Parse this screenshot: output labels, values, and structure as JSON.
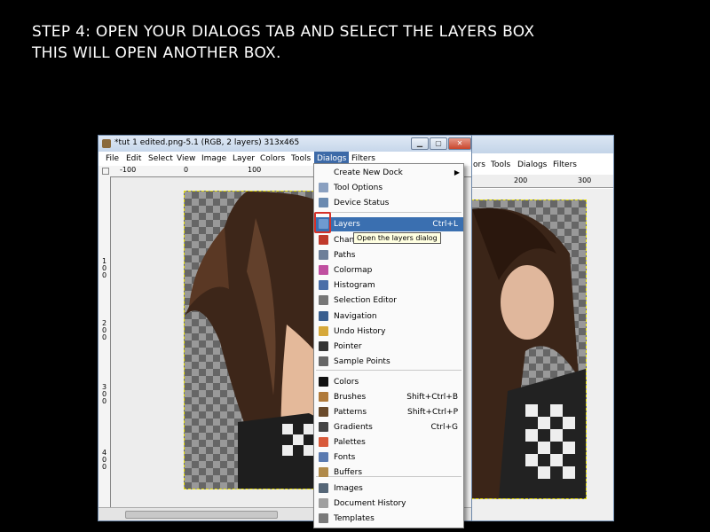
{
  "caption": {
    "line1": "STEP 4: OPEN YOUR DIALOGS TAB AND SELECT THE LAYERS BOX",
    "line2": "THIS WILL OPEN ANOTHER BOX."
  },
  "window": {
    "title": "*tut 1 edited.png-5.1 (RGB, 2 layers) 313x465",
    "controls": {
      "minimize": "▁",
      "maximize": "▢",
      "close": "✕"
    },
    "menubar": [
      "File",
      "Edit",
      "Select",
      "View",
      "Image",
      "Layer",
      "Colors",
      "Tools",
      "Dialogs",
      "Filters"
    ],
    "active_menu": "Dialogs",
    "ruler_labels": [
      "-100",
      "0",
      "100"
    ],
    "vruler_labels": [
      "100",
      "200",
      "300",
      "400"
    ]
  },
  "back_window": {
    "menubar": [
      "ors",
      "Tools",
      "Dialogs",
      "Filters"
    ],
    "ruler_labels": [
      "200",
      "300"
    ]
  },
  "dialogs_menu": {
    "items": [
      {
        "label": "Create New Dock",
        "shortcut": "",
        "submenu": true,
        "icon": ""
      },
      {
        "label": "Tool Options",
        "shortcut": "",
        "icon": "tool-options-icon",
        "color": "#8aa0c0"
      },
      {
        "label": "Device Status",
        "shortcut": "",
        "icon": "device-status-icon",
        "color": "#6a8ab0"
      },
      {
        "label": "Layers",
        "shortcut": "Ctrl+L",
        "icon": "layers-icon",
        "color": "#6f9ad0",
        "highlighted": true
      },
      {
        "label": "Chann",
        "shortcut": "",
        "icon": "channels-icon",
        "color": "#c0392b"
      },
      {
        "label": "Paths",
        "shortcut": "",
        "icon": "paths-icon",
        "color": "#6d7f99"
      },
      {
        "label": "Colormap",
        "shortcut": "",
        "icon": "colormap-icon",
        "color": "#c04fa0"
      },
      {
        "label": "Histogram",
        "shortcut": "",
        "icon": "histogram-icon",
        "color": "#4a6ea8"
      },
      {
        "label": "Selection Editor",
        "shortcut": "",
        "icon": "selection-editor-icon",
        "color": "#777777"
      },
      {
        "label": "Navigation",
        "shortcut": "",
        "icon": "navigation-icon",
        "color": "#3a5f8f"
      },
      {
        "label": "Undo History",
        "shortcut": "",
        "icon": "undo-history-icon",
        "color": "#d6a83a"
      },
      {
        "label": "Pointer",
        "shortcut": "",
        "icon": "pointer-icon",
        "color": "#333333"
      },
      {
        "label": "Sample Points",
        "shortcut": "",
        "icon": "sample-points-icon",
        "color": "#666666"
      },
      {
        "label": "Colors",
        "shortcut": "",
        "icon": "colors-icon",
        "color": "#111111"
      },
      {
        "label": "Brushes",
        "shortcut": "Shift+Ctrl+B",
        "icon": "brushes-icon",
        "color": "#b07a3a"
      },
      {
        "label": "Patterns",
        "shortcut": "Shift+Ctrl+P",
        "icon": "patterns-icon",
        "color": "#6a4a2a"
      },
      {
        "label": "Gradients",
        "shortcut": "Ctrl+G",
        "icon": "gradients-icon",
        "color": "#444444"
      },
      {
        "label": "Palettes",
        "shortcut": "",
        "icon": "palettes-icon",
        "color": "#d85a3a"
      },
      {
        "label": "Fonts",
        "shortcut": "",
        "icon": "fonts-icon",
        "color": "#5a7ab0"
      },
      {
        "label": "Buffers",
        "shortcut": "",
        "icon": "buffers-icon",
        "color": "#b08a4a"
      },
      {
        "label": "Images",
        "shortcut": "",
        "icon": "images-icon",
        "color": "#556677"
      },
      {
        "label": "Document History",
        "shortcut": "",
        "icon": "document-history-icon",
        "color": "#a0a0a0"
      },
      {
        "label": "Templates",
        "shortcut": "",
        "icon": "templates-icon",
        "color": "#7a7a7a"
      }
    ]
  },
  "tooltip": "Open the layers dialog",
  "colors": {
    "highlight": "#3a6fb0",
    "annotation_box": "#d4312a"
  }
}
